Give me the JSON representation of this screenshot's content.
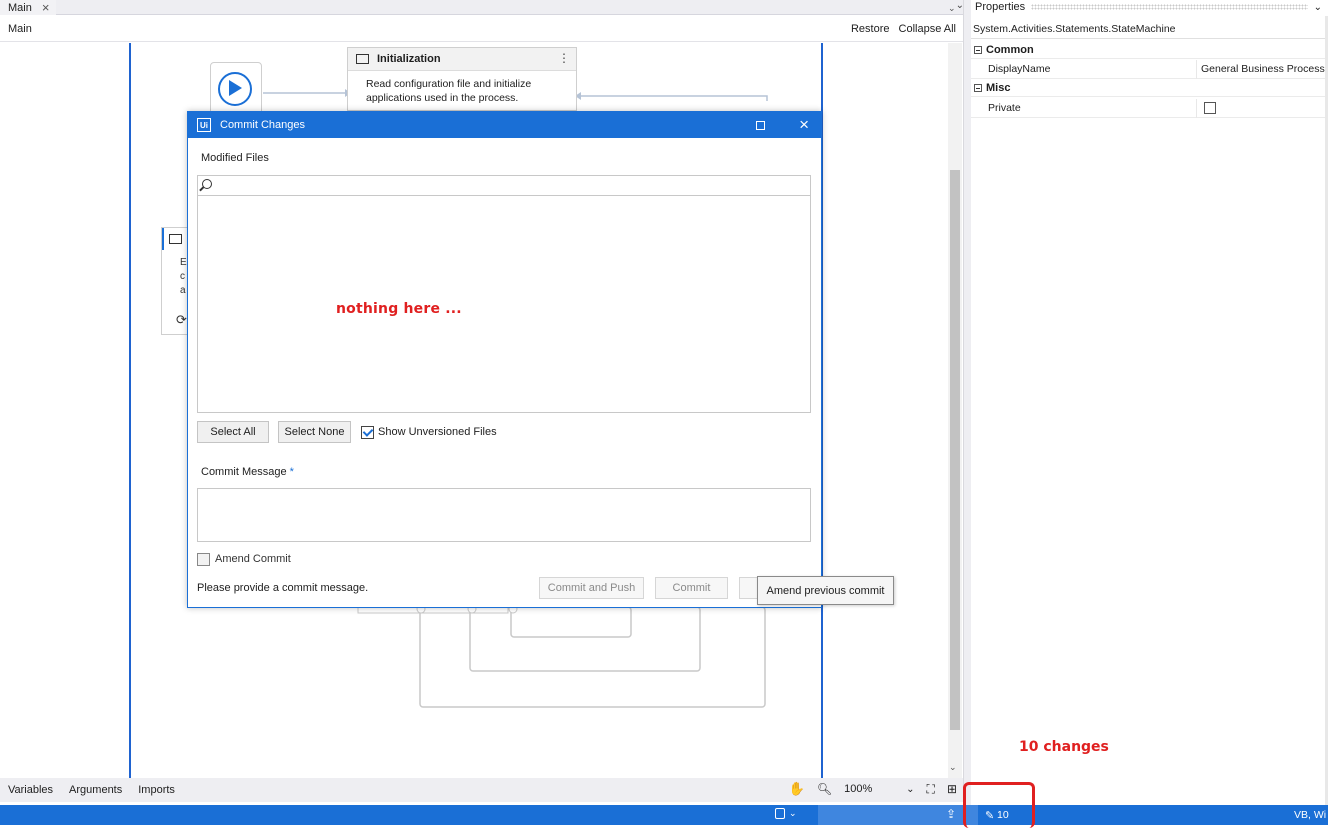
{
  "document": {
    "tab_label": "Main",
    "breadcrumb": "Main",
    "restore_label": "Restore",
    "collapse_label": "Collapse All"
  },
  "workflow": {
    "init_state": {
      "title": "Initialization",
      "description": "Read configuration file and initialize applications used in the process."
    },
    "state2_lines": [
      "E",
      "c",
      "a"
    ]
  },
  "dialog": {
    "title": "Commit Changes",
    "modified_files_label": "Modified Files",
    "search_placeholder": "",
    "select_all_label": "Select All",
    "select_none_label": "Select None",
    "show_unversioned_label": "Show Unversioned Files",
    "show_unversioned_checked": true,
    "commit_message_label": "Commit Message",
    "commit_message_required": "*",
    "amend_label": "Amend Commit",
    "amend_checked": false,
    "status_message": "Please provide a commit message.",
    "commit_push_label": "Commit and Push",
    "commit_label": "Commit",
    "amend_tooltip": "Amend previous commit"
  },
  "annotations": {
    "empty_list": "nothing here ...",
    "changes": "10 changes"
  },
  "properties": {
    "header": "Properties",
    "type_name": "System.Activities.Statements.StateMachine",
    "categories": [
      {
        "name": "Common",
        "rows": [
          {
            "name": "DisplayName",
            "value": "General Business Process"
          }
        ]
      },
      {
        "name": "Misc",
        "rows": [
          {
            "name": "Private",
            "value": false
          }
        ]
      }
    ]
  },
  "bottom_bar": {
    "tabs": [
      "Variables",
      "Arguments",
      "Imports"
    ],
    "zoom": "100%"
  },
  "status_bar": {
    "changes_count": "10",
    "language": "VB, Wi"
  },
  "colors": {
    "accent": "#1a6fd6",
    "annotation_red": "#e02020"
  }
}
